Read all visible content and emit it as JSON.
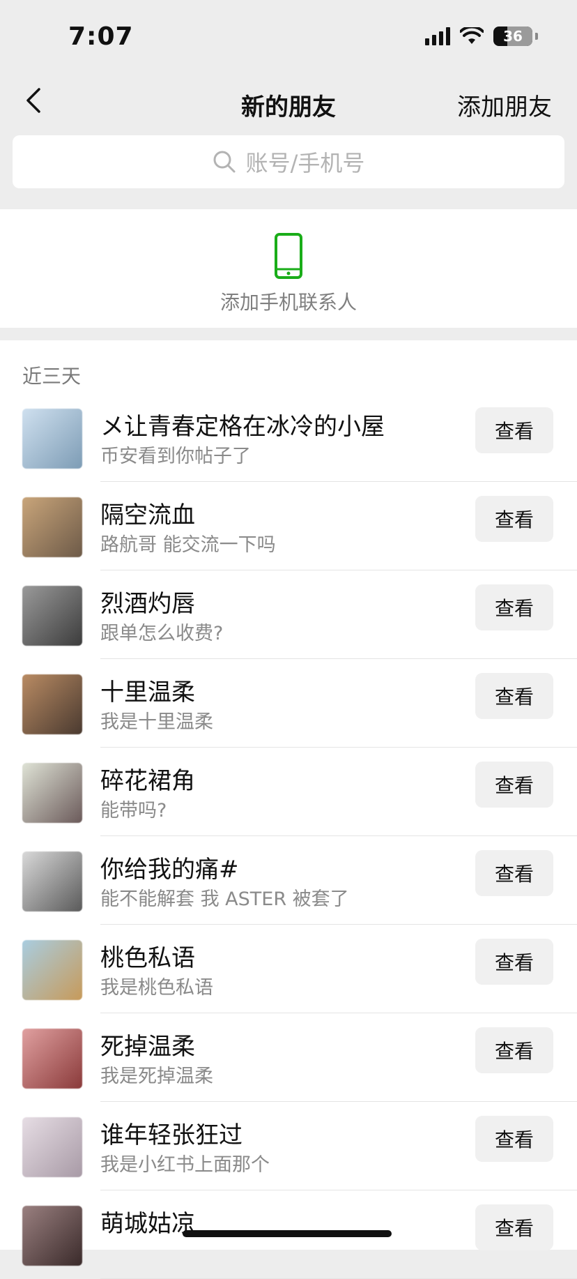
{
  "status_bar": {
    "time": "7:07",
    "battery_percent": "36",
    "battery_level": 0.36
  },
  "nav": {
    "title": "新的朋友",
    "right_action": "添加朋友",
    "back_icon": "chevron-left-icon"
  },
  "search": {
    "placeholder": "账号/手机号",
    "icon": "search-icon"
  },
  "add_contacts": {
    "label": "添加手机联系人",
    "icon": "phone-icon",
    "icon_color": "#1aad19"
  },
  "section_header": "近三天",
  "contacts": [
    {
      "name": "メ让青春定格在冰冷的小屋",
      "message": "币安看到你帖子了",
      "action": "查看",
      "avatar_colors": [
        "#cfe0ef",
        "#7d9cb5"
      ]
    },
    {
      "name": "隔空流血",
      "message": "路航哥 能交流一下吗",
      "action": "查看",
      "avatar_colors": [
        "#c9a57a",
        "#6d5a48"
      ]
    },
    {
      "name": "烈酒灼唇",
      "message": "跟单怎么收费?",
      "action": "查看",
      "avatar_colors": [
        "#9a9a9a",
        "#3c3c3c"
      ]
    },
    {
      "name": "十里温柔",
      "message": "我是十里温柔",
      "action": "查看",
      "avatar_colors": [
        "#b98b63",
        "#4a3a30"
      ]
    },
    {
      "name": "碎花裙角",
      "message": "能带吗?",
      "action": "查看",
      "avatar_colors": [
        "#dfe3d6",
        "#6b5a5a"
      ]
    },
    {
      "name": "你给我的痛#",
      "message": "能不能解套 我 ASTER 被套了",
      "action": "查看",
      "avatar_colors": [
        "#d9d9d9",
        "#5a5a5a"
      ]
    },
    {
      "name": "桃色私语",
      "message": "我是桃色私语",
      "action": "查看",
      "avatar_colors": [
        "#a9cde0",
        "#c79a5a"
      ]
    },
    {
      "name": "死掉温柔",
      "message": "我是死掉温柔",
      "action": "查看",
      "avatar_colors": [
        "#e0a0a0",
        "#8a3a3a"
      ]
    },
    {
      "name": "谁年轻张狂过",
      "message": "我是小红书上面那个",
      "action": "查看",
      "avatar_colors": [
        "#e6dde4",
        "#a89aa6"
      ]
    },
    {
      "name": "萌城姑凉",
      "message": "",
      "action": "查看",
      "avatar_colors": [
        "#9a8080",
        "#3a2a2a"
      ]
    }
  ]
}
